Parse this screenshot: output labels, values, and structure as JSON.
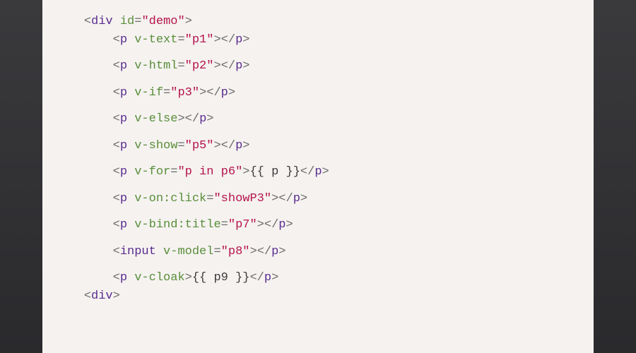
{
  "code": {
    "indent1": "    ",
    "indent2": "        ",
    "lt": "<",
    "gt": ">",
    "ltSlash": "</",
    "eq": "=",
    "q": "\"",
    "tags": {
      "div": "div",
      "p": "p",
      "input": "input"
    },
    "attrs": {
      "id": "id",
      "vtext": "v-text",
      "vhtml": "v-html",
      "vif": "v-if",
      "velse": "v-else",
      "vshow": "v-show",
      "vfor": "v-for",
      "vonclick": "v-on:click",
      "vbindtitle": "v-bind:title",
      "vmodel": "v-model",
      "vcloak": "v-cloak"
    },
    "vals": {
      "demo": "demo",
      "p1": "p1",
      "p2": "p2",
      "p3": "p3",
      "p5": "p5",
      "pInP6": "p in p6",
      "showP3": "showP3",
      "p7": "p7",
      "p8": "p8"
    },
    "mustache": {
      "pp": "{{ p }}",
      "p9": "{{ p9 }}"
    }
  }
}
